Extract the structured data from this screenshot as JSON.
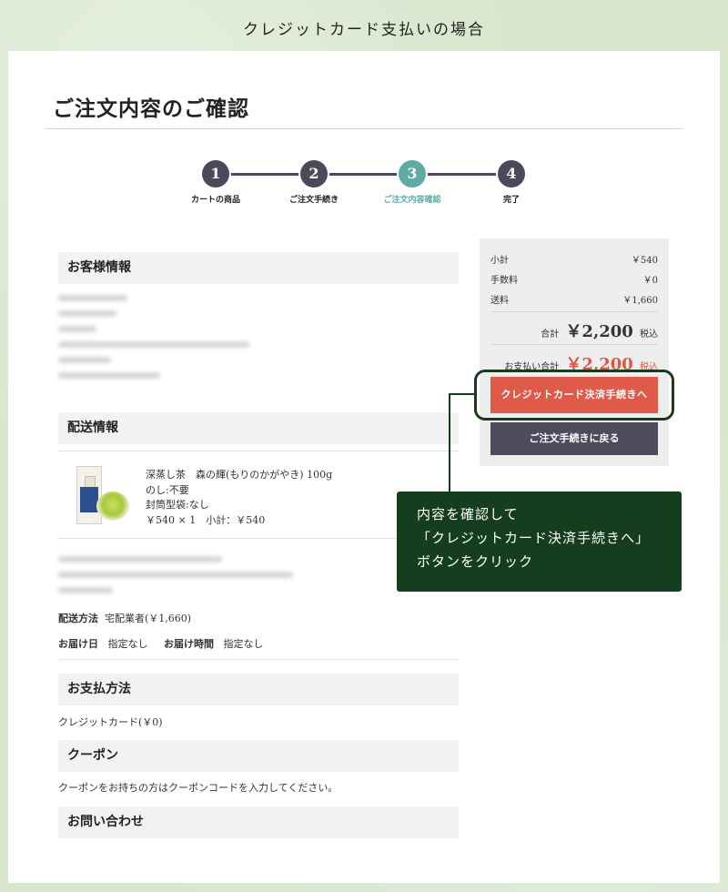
{
  "caption": "クレジットカード支払いの場合",
  "page_title": "ご注文内容のご確認",
  "steps": [
    {
      "num": "1",
      "label": "カートの商品"
    },
    {
      "num": "2",
      "label": "ご注文手続き"
    },
    {
      "num": "3",
      "label": "ご注文内容確認"
    },
    {
      "num": "4",
      "label": "完了"
    }
  ],
  "sections": {
    "customer": "お客様情報",
    "delivery": "配送情報",
    "payment": "お支払方法",
    "coupon": "クーポン",
    "inquiry": "お問い合わせ"
  },
  "product": {
    "name": "深蒸し茶　森の輝(もりのかがやき) 100g",
    "noshi": "のし:不要",
    "envelope": "封筒型袋:なし",
    "price_line": "￥540 × 1　小計：￥540"
  },
  "delivery_info": {
    "method_label": "配送方法",
    "method_value": "宅配業者(￥1,660)",
    "date_label": "お届け日",
    "date_value": "指定なし",
    "time_label": "お届け時間",
    "time_value": "指定なし"
  },
  "payment_value": "クレジットカード(￥0)",
  "coupon_text": "クーポンをお持ちの方はクーポンコードを入力してください。",
  "summary": {
    "subtotal_label": "小計",
    "subtotal_value": "￥540",
    "fee_label": "手数料",
    "fee_value": "￥0",
    "shipping_label": "送料",
    "shipping_value": "￥1,660",
    "total_label": "合計",
    "total_value": "￥2,200",
    "tax_label": "税込",
    "pay_label": "お支払い合計",
    "pay_value": "￥2,200",
    "pay_tax": "税込"
  },
  "buttons": {
    "card": "クレジットカード決済手続きへ",
    "back": "ご注文手続きに戻る"
  },
  "callout": {
    "line1": "内容を確認して",
    "line2": "「クレジットカード決済手続きへ」",
    "line3": "ボタンをクリック"
  },
  "colors": {
    "accent_step": "#5faaa4",
    "card_button": "#e05a4a",
    "back_button": "#4c4c5c",
    "callout_bg": "#143e1d"
  }
}
